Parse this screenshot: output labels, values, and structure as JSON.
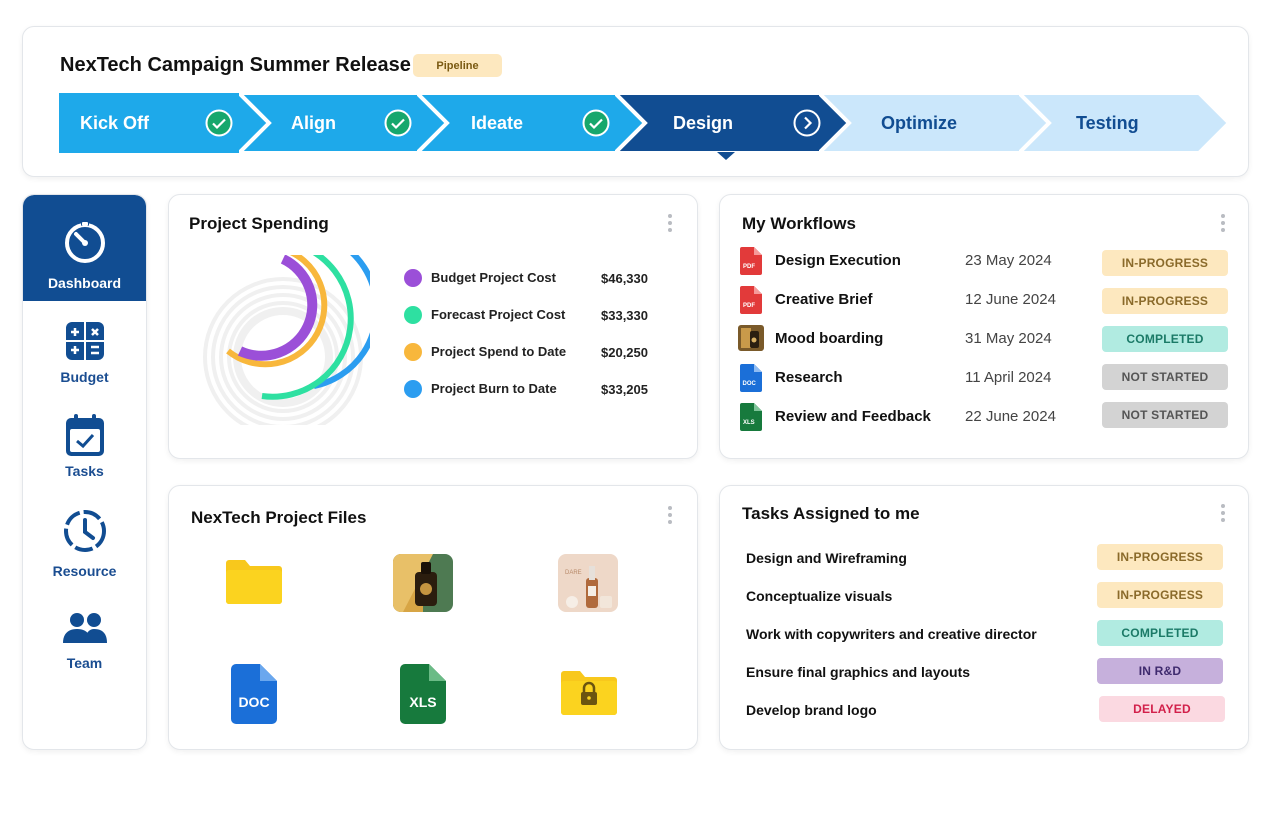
{
  "header": {
    "title": "NexTech Campaign Summer Release",
    "badge": "Pipeline",
    "steps": [
      {
        "label": "Kick Off",
        "state": "done"
      },
      {
        "label": "Align",
        "state": "done"
      },
      {
        "label": "Ideate",
        "state": "done"
      },
      {
        "label": "Design",
        "state": "current"
      },
      {
        "label": "Optimize",
        "state": "upcoming"
      },
      {
        "label": "Testing",
        "state": "upcoming"
      }
    ]
  },
  "sidebar": {
    "items": [
      {
        "label": "Dashboard",
        "icon": "timer-icon",
        "active": true
      },
      {
        "label": "Budget",
        "icon": "calculator-icon"
      },
      {
        "label": "Tasks",
        "icon": "calendar-check-icon"
      },
      {
        "label": "Resource",
        "icon": "clock-icon"
      },
      {
        "label": "Team",
        "icon": "team-icon"
      }
    ]
  },
  "spending": {
    "title": "Project Spending",
    "items": [
      {
        "label": "Budget Project Cost",
        "amount": "$46,330",
        "color": "#9b4fd8"
      },
      {
        "label": "Forecast Project Cost",
        "amount": "$33,330",
        "color": "#2ee0a1"
      },
      {
        "label": "Project Spend to Date",
        "amount": "$20,250",
        "color": "#f8b73c"
      },
      {
        "label": "Project Burn to Date",
        "amount": "$33,205",
        "color": "#2b9df0"
      }
    ]
  },
  "workflows": {
    "title": "My Workflows",
    "rows": [
      {
        "name": "Design Execution",
        "date": "23 May 2024",
        "status": "IN-PROGRESS",
        "file": "PDF"
      },
      {
        "name": "Creative Brief",
        "date": "12 June 2024",
        "status": "IN-PROGRESS",
        "file": "PDF"
      },
      {
        "name": "Mood boarding",
        "date": "31 May 2024",
        "status": "COMPLETED",
        "file": "image"
      },
      {
        "name": "Research",
        "date": "11 April 2024",
        "status": "NOT STARTED",
        "file": "DOC"
      },
      {
        "name": "Review and Feedback",
        "date": "22 June 2024",
        "status": "NOT STARTED",
        "file": "XLS"
      }
    ]
  },
  "files": {
    "title": "NexTech Project Files",
    "items": [
      {
        "type": "folder-icon"
      },
      {
        "type": "image-thumbnail"
      },
      {
        "type": "image-thumbnail",
        "text": "DARE"
      },
      {
        "type": "doc-file-icon",
        "text": "DOC"
      },
      {
        "type": "xls-file-icon",
        "text": "XLS"
      },
      {
        "type": "locked-folder-icon"
      }
    ]
  },
  "tasks": {
    "title": "Tasks Assigned to me",
    "rows": [
      {
        "name": "Design and Wireframing",
        "status": "IN-PROGRESS"
      },
      {
        "name": "Conceptualize visuals",
        "status": "IN-PROGRESS"
      },
      {
        "name": "Work with copywriters and creative director",
        "status": "COMPLETED"
      },
      {
        "name": "Ensure final graphics and layouts",
        "status": "IN R&D"
      },
      {
        "name": "Develop brand logo",
        "status": "DELAYED"
      }
    ]
  }
}
